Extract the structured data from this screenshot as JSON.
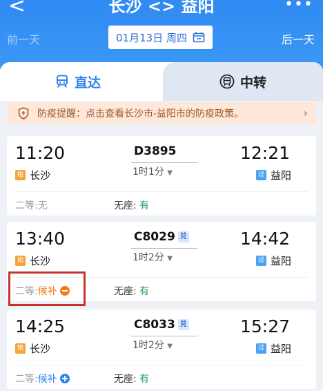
{
  "header": {
    "title": "长沙 <> 益阳",
    "back_icon": "<",
    "more_icon": "•••",
    "prev_day": "前一天",
    "next_day": "后一天",
    "date": "01月13日 周四"
  },
  "tabs": [
    {
      "label": "直达",
      "icon": "train-icon",
      "active": true
    },
    {
      "label": "中转",
      "icon": "transfer-icon",
      "active": false
    }
  ],
  "notice": {
    "text": "防疫提醒：点击查看长沙市-益阳市的防疫政策。",
    "arrow": "›"
  },
  "trains": [
    {
      "depart": "11:20",
      "arrive": "12:21",
      "number": "D3895",
      "badge": "",
      "duration": "1时1分",
      "from": "长沙",
      "to": "益阳",
      "from_tag": "始",
      "to_tag": "过",
      "second_class_label": "二等:",
      "second_class_value": "无",
      "second_class_icon": "",
      "no_seat_label": "无座:",
      "no_seat_value": "有"
    },
    {
      "depart": "13:40",
      "arrive": "14:42",
      "number": "C8029",
      "badge": "兑",
      "duration": "1时2分",
      "from": "长沙",
      "to": "益阳",
      "from_tag": "始",
      "to_tag": "过",
      "second_class_label": "二等:",
      "second_class_value": "候补",
      "second_class_icon": "minus-circle-icon",
      "no_seat_label": "无座:",
      "no_seat_value": "有"
    },
    {
      "depart": "14:25",
      "arrive": "15:27",
      "number": "C8033",
      "badge": "兑",
      "duration": "1时2分",
      "from": "长沙",
      "to": "益阳",
      "from_tag": "始",
      "to_tag": "过",
      "second_class_label": "二等:",
      "second_class_value": "候补",
      "second_class_icon": "plus-circle-icon",
      "no_seat_label": "无座:",
      "no_seat_value": "有"
    }
  ],
  "colors": {
    "header_blue": "#2f8af2",
    "active_tab": "#2f83ee",
    "seat_available": "#21a35b",
    "waitlist_orange": "#f07c1c",
    "highlight_red": "#c4342f"
  }
}
